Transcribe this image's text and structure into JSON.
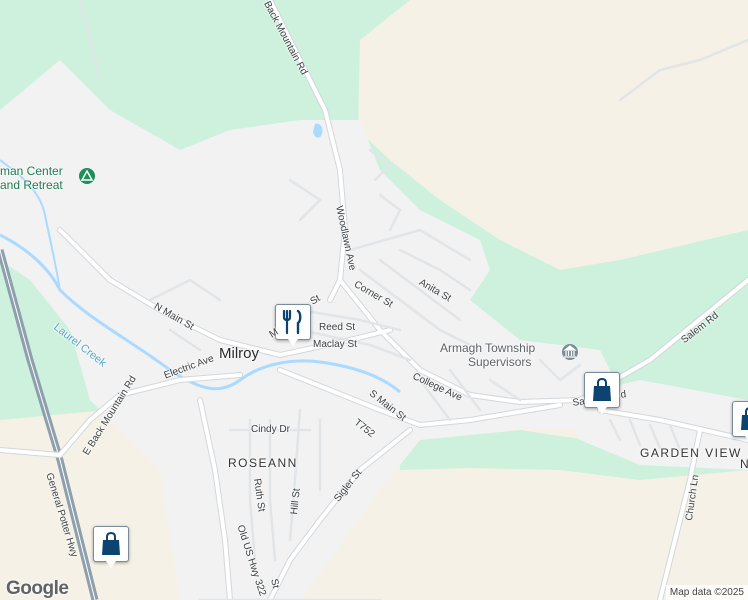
{
  "colors": {
    "forest": "#cdf1dd",
    "land": "#f5f1e6",
    "developed": "#f2f2f2",
    "road": "#ffffff",
    "highway": "#8e9fad",
    "water": "#aadaff",
    "pin": "#0d4370"
  },
  "places": {
    "town": "Milroy",
    "roseann": "ROSEANN",
    "garden_view": "GARDEN VIEW",
    "garden_view_tail": "N"
  },
  "water": {
    "creek": "Laurel Creek"
  },
  "pois": {
    "retreat_line1": "man Center",
    "retreat_line2": "and Retreat",
    "township_line1": "Armagh Township",
    "township_line2": "Supervisors"
  },
  "roads": {
    "back_mountain": "Back Mountain Rd",
    "woodlawn": "Woodlawn Ave",
    "corner": "Corner St",
    "anita": "Anita St",
    "n_main": "N Main St",
    "reed": "Reed St",
    "maclay": "Maclay St",
    "main_partial": "M",
    "st_partial": "St",
    "electric": "Electric Ave",
    "e_back_mountain": "E Back Mountain Rd",
    "college": "College Ave",
    "s_main": "S Main St",
    "t752": "T752",
    "cindy": "Cindy Dr",
    "sigler": "Sigler St",
    "ruth": "Ruth St",
    "hill": "Hill St",
    "old_us_322": "Old US Hwy 322",
    "st_bottom": "St",
    "general_potter": "General Potter Hwy",
    "salem": "Salem Rd",
    "salem_partial": "Sa",
    "salem_partial2": "d",
    "church": "Church Ln"
  },
  "icons": [
    "park-icon",
    "restaurant-icon",
    "civic-building-icon",
    "shopping-bag-icon"
  ],
  "attribution": {
    "logo": "Google",
    "credit": "Map data ©2025"
  }
}
